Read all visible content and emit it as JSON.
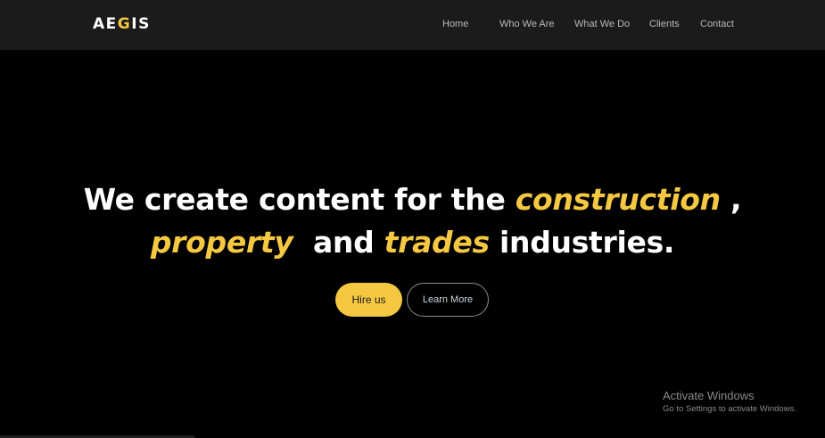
{
  "logo": {
    "part1": "AE",
    "accent": "G",
    "part2": "IS"
  },
  "nav": {
    "items": [
      {
        "label": "Home"
      },
      {
        "label": "Who We Are"
      },
      {
        "label": "What We Do"
      },
      {
        "label": "Clients"
      },
      {
        "label": "Contact"
      }
    ]
  },
  "hero": {
    "line1_text": "We create content for the ",
    "line1_highlight": "construction",
    "line1_end": " ,",
    "line2_highlight1": "property",
    "line2_mid": "  and ",
    "line2_highlight2": "trades",
    "line2_end": " industries."
  },
  "buttons": {
    "hire": "Hire us",
    "learn": "Learn More"
  },
  "watermark": {
    "title": "Activate Windows",
    "subtitle": "Go to Settings to activate Windows."
  },
  "colors": {
    "accent": "#f5c842",
    "background": "#000000",
    "navbar": "#1b1b1b"
  }
}
